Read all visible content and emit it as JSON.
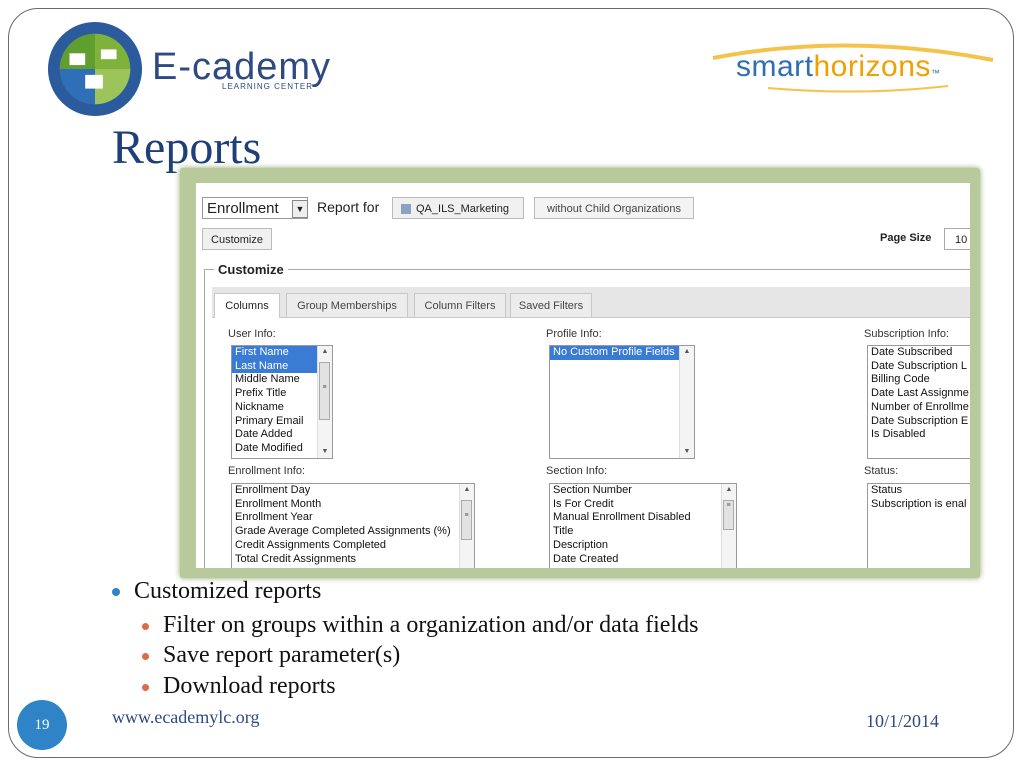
{
  "header": {
    "logo_name": "E-cademy",
    "logo_sub": "LEARNING CENTER",
    "logo_ring_text_top": "E-CADEMY",
    "logo_ring_text_bottom": "LEARNING CENTER",
    "partner_logo_a": "smart",
    "partner_logo_b": "horizons",
    "partner_tm": "™"
  },
  "title": "Reports",
  "screenshot": {
    "report_type": "Enrollment",
    "report_for_label": "Report for",
    "org_button": "QA_ILS_Marketing",
    "child_button": "without Child Organizations",
    "customize_button": "Customize",
    "page_size_label": "Page Size",
    "page_size_value": "10",
    "customize_legend": "Customize",
    "tabs": [
      "Columns",
      "Group Memberships",
      "Column Filters",
      "Saved Filters"
    ],
    "user_info": {
      "label": "User Info:",
      "items": [
        "First Name",
        "Last Name",
        "Middle Name",
        "Prefix Title",
        "Nickname",
        "Primary Email",
        "Date Added",
        "Date Modified"
      ]
    },
    "profile_info": {
      "label": "Profile Info:",
      "items": [
        "No Custom Profile Fields"
      ]
    },
    "subscription_info": {
      "label": "Subscription Info:",
      "items": [
        "Date Subscribed",
        "Date Subscription L",
        "Billing Code",
        "Date Last Assignme",
        "Number of Enrollme",
        "Date Subscription E",
        "Is Disabled"
      ]
    },
    "enrollment_info": {
      "label": "Enrollment Info:",
      "items": [
        "Enrollment Day",
        "Enrollment Month",
        "Enrollment Year",
        "Grade Average Completed Assignments (%)",
        "Credit Assignments Completed",
        "Total Credit Assignments"
      ]
    },
    "section_info": {
      "label": "Section Info:",
      "items": [
        "Section Number",
        "Is For Credit",
        "Manual Enrollment Disabled",
        "Title",
        "Description",
        "Date Created"
      ]
    },
    "status": {
      "label": "Status:",
      "items": [
        "Status",
        "Subscription is enal"
      ]
    }
  },
  "bullets": {
    "main": "Customized reports",
    "subs": [
      "Filter on groups within a organization and/or data fields",
      "Save report parameter(s)",
      "Download reports"
    ]
  },
  "footer": {
    "page_number": "19",
    "url": "www.ecademylc.org",
    "date": "10/1/2014"
  }
}
